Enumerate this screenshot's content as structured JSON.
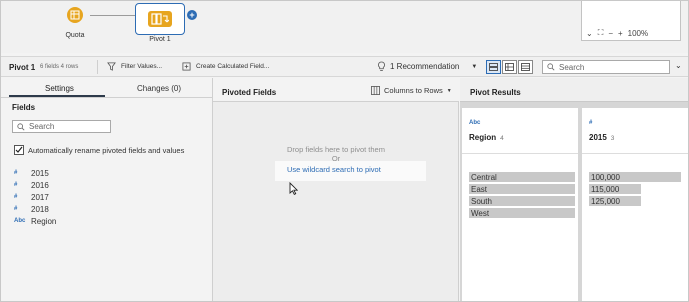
{
  "flow": {
    "quota_label": "Quota",
    "pivot_label": "Pivot 1",
    "zoom_level": "100%"
  },
  "toolbar": {
    "step_name": "Pivot 1",
    "step_meta": "6 fields  4 rows",
    "filter_label": "Filter Values...",
    "calc_label": "Create Calculated Field...",
    "recommendation_label": "1 Recommendation",
    "search_placeholder": "Search"
  },
  "left_panel": {
    "tabs": [
      {
        "label": "Settings"
      },
      {
        "label": "Changes (0)"
      }
    ],
    "fields_heading": "Fields",
    "search_placeholder": "Search",
    "auto_rename_label": "Automatically rename pivoted fields and values",
    "auto_rename_checked": true,
    "fields": [
      {
        "type": "#",
        "name": "2015"
      },
      {
        "type": "#",
        "name": "2016"
      },
      {
        "type": "#",
        "name": "2017"
      },
      {
        "type": "#",
        "name": "2018"
      },
      {
        "type": "Abc",
        "name": "Region"
      }
    ]
  },
  "middle_panel": {
    "title": "Pivoted Fields",
    "pivot_mode": "Columns to Rows",
    "drop_hint": "Drop fields here to pivot them",
    "or_text": "Or",
    "wildcard_link": "Use wildcard search to pivot"
  },
  "right_panel": {
    "title": "Pivot Results",
    "columns": [
      {
        "type": "Abc",
        "name": "Region",
        "count": "4",
        "values": [
          {
            "label": "Central",
            "bar_fraction": 1.0
          },
          {
            "label": "East",
            "bar_fraction": 1.0
          },
          {
            "label": "South",
            "bar_fraction": 1.0
          },
          {
            "label": "West",
            "bar_fraction": 1.0
          }
        ]
      },
      {
        "type": "#",
        "name": "2015",
        "count": "3",
        "values": [
          {
            "label": "100,000",
            "bar_fraction": 1.0
          },
          {
            "label": "115,000",
            "bar_fraction": 0.55
          },
          {
            "label": "125,000",
            "bar_fraction": 0.55
          }
        ]
      }
    ]
  },
  "colors": {
    "accent": "#2d6cb4",
    "node_orange": "#e7a51f"
  }
}
